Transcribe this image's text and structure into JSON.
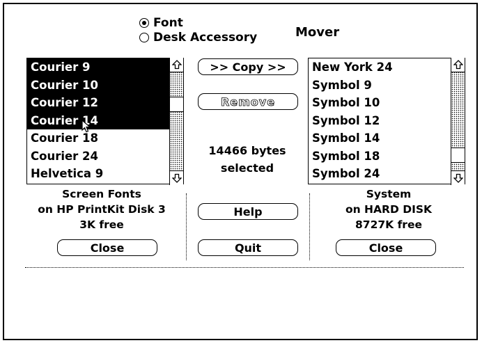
{
  "window": {
    "title": "Mover"
  },
  "mode": {
    "font_label": "Font",
    "desk_accessory_label": "Desk Accessory",
    "selected": "Font"
  },
  "left_list": {
    "items": [
      "Courier 9",
      "Courier 10",
      "Courier 12",
      "Courier 14",
      "Courier 18",
      "Courier 24",
      "Helvetica 9"
    ],
    "selected": [
      true,
      true,
      true,
      true,
      false,
      false,
      false
    ],
    "scroll_position": 0.3,
    "caption_line1": "Screen Fonts",
    "caption_line2": "on HP PrintKit Disk 3",
    "caption_line3": "3K free",
    "close_label": "Close"
  },
  "right_list": {
    "items": [
      "New York 24",
      "Symbol 9",
      "Symbol 10",
      "Symbol 12",
      "Symbol 14",
      "Symbol 18",
      "Symbol 24"
    ],
    "scroll_position": 0.9,
    "caption_line1": "System",
    "caption_line2": "on HARD DISK",
    "caption_line3": "8727K free",
    "close_label": "Close"
  },
  "center": {
    "copy_label": ">> Copy >>",
    "remove_label": "Remove",
    "bytes_line1": "14466 bytes",
    "bytes_line2": "selected",
    "help_label": "Help",
    "quit_label": "Quit"
  },
  "icons": {
    "scroll_up": "up-arrow-icon",
    "scroll_down": "down-arrow-icon",
    "cursor": "arrow-cursor-icon"
  },
  "colors": {
    "foreground": "#000000",
    "background": "#ffffff",
    "selection": "#000000"
  }
}
